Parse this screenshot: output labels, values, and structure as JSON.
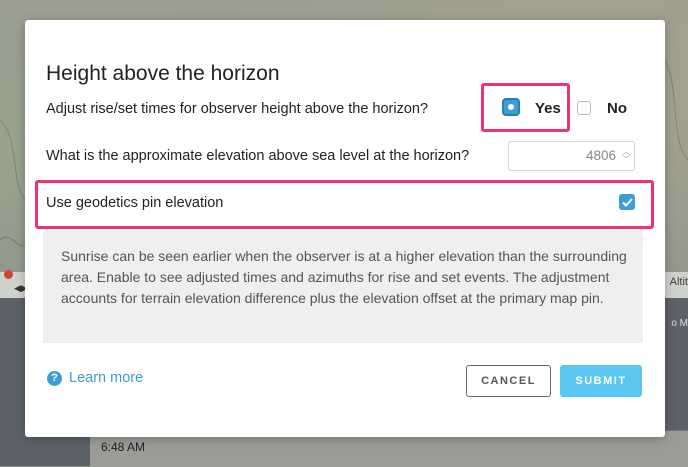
{
  "background": {
    "time_text": "6:48 AM",
    "altitude_text": "Altit",
    "map_label_text": "o M"
  },
  "dialog": {
    "title": "Height above the horizon",
    "question_adjust": "Adjust rise/set times for observer height above the horizon?",
    "yes_label": "Yes",
    "no_label": "No",
    "yes_selected": true,
    "question_elevation": "What is the approximate elevation above sea level at the horizon?",
    "elevation_value": "4806",
    "geodetics_label": "Use geodetics pin elevation",
    "geodetics_checked": true,
    "info_text": "Sunrise can be seen earlier when the observer is at a higher elevation than the surrounding area. Enable to see adjusted times and azimuths for rise and set events. The adjustment accounts for terrain elevation difference plus the elevation offset at the primary map pin.",
    "help_link": "Learn more",
    "cancel_label": "CANCEL",
    "submit_label": "SUBMIT"
  },
  "colors": {
    "accent": "#3a9fd6",
    "highlight": "#f2326f",
    "submit": "#5bc6ef"
  }
}
